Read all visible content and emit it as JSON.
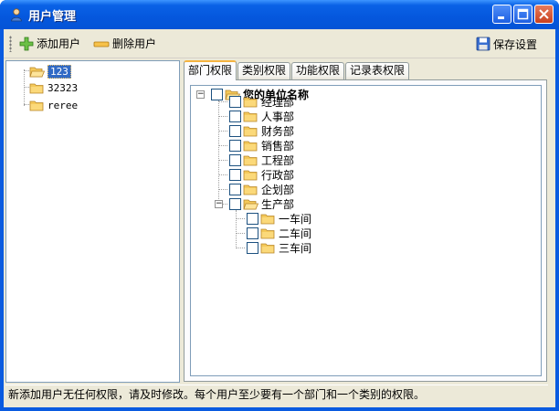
{
  "window": {
    "title": "用户管理"
  },
  "toolbar": {
    "add_user": "添加用户",
    "delete_user": "删除用户",
    "save_settings": "保存设置"
  },
  "users": {
    "items": [
      "123",
      "32323",
      "reree"
    ],
    "selected": "123"
  },
  "tabs": [
    {
      "label": "部门权限",
      "active": true
    },
    {
      "label": "类别权限",
      "active": false
    },
    {
      "label": "功能权限",
      "active": false
    },
    {
      "label": "记录表权限",
      "active": false
    }
  ],
  "tree": {
    "root": "您的单位名称",
    "departments": [
      "经理部",
      "人事部",
      "财务部",
      "销售部",
      "工程部",
      "行政部",
      "企划部",
      "生产部"
    ],
    "production_children": [
      "一车间",
      "二车间",
      "三车间"
    ]
  },
  "status": {
    "message": "新添加用户无任何权限，请及时修改。每个用户至少要有一个部门和一个类别的权限。"
  }
}
